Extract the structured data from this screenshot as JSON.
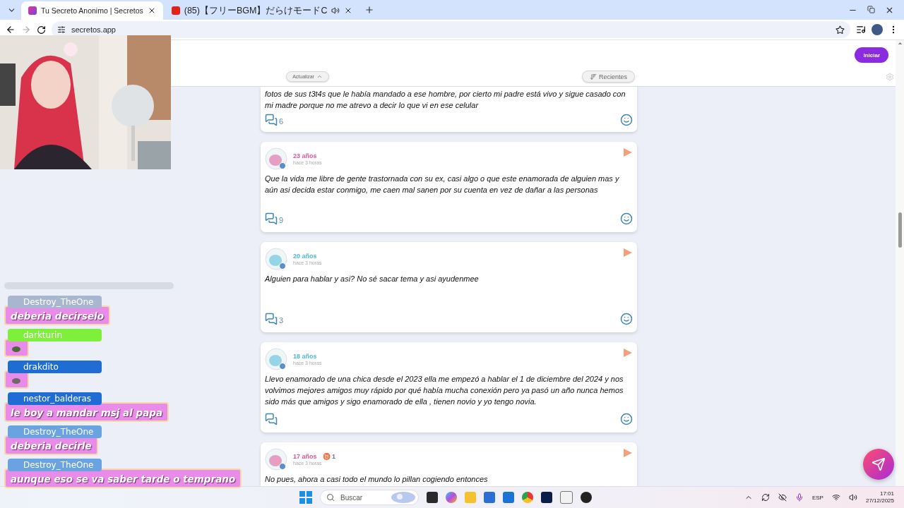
{
  "browser": {
    "tabs": [
      {
        "title": "Tu Secreto Anonimo | Secretos",
        "selected": true,
        "kind": "site",
        "audio": false
      },
      {
        "title": "(85)【フリーBGM】だらけモードC",
        "selected": false,
        "kind": "video",
        "audio": true
      }
    ],
    "address": "secretos.app"
  },
  "site": {
    "header": {
      "login_button": "Iniciar",
      "refresh_button": "Actualizar",
      "sort_button": "Recientes"
    },
    "posts": [
      {
        "text": "fotos de sus t3t4s que le había mandado a ese hombre, por cierto mi padre está vivo y sigue casado con mi madre porque no me atrevo a decir lo que vi en ese celular",
        "comments": "6",
        "footer": true
      },
      {
        "age": "23 años",
        "color": "#e0559a",
        "time": "hace 3 horas",
        "text": "Que la vida me libre de gente trastornada con su ex, casi algo o que este enamorada de alguien mas y aún asi decida estar conmigo, me caen mal sanen por su cuenta en vez de dañar a las personas",
        "comments": "9",
        "footer": true
      },
      {
        "age": "20 años",
        "color": "#4fb8dc",
        "time": "hace 3 horas",
        "text": "Alguien para hablar y asi? No sé sacar tema y asi ayudenmee",
        "comments": "3",
        "footer": true
      },
      {
        "age": "18 años",
        "color": "#4fb8dc",
        "time": "hace 3 horas",
        "text": "Llevo enamorado de una chica desde el 2023 ella me empezó a hablar el 1 de diciembre del 2024 y nos volvimos mejores amigos muy rápido por qué había mucha conexión pero ya pasó un año nunca hemos sido más que amigos y sigo enamorado de ella , tienen novio y yo tengo novia.",
        "footer": true
      },
      {
        "age": "17 años",
        "color": "#e0559a",
        "badge": "♉ 1",
        "time": "hace 3 horas",
        "text": "No pues, ahora a casi todo el mundo lo pillan cogiendo entonces"
      }
    ]
  },
  "stream_overlay": {
    "chat": [
      {
        "user": "Destroy_TheOne",
        "color": "#a9b6cf",
        "kind": "text",
        "message": "deberia decirselo"
      },
      {
        "user": "darkturin",
        "color": "#7ef03c",
        "kind": "emote"
      },
      {
        "user": "drakdito",
        "color": "#1f6dd4",
        "kind": "emote"
      },
      {
        "user": "nestor_balderas",
        "color": "#1f6dd4",
        "kind": "text",
        "message": "le boy a mandar msj al papa"
      },
      {
        "user": "Destroy_TheOne",
        "color": "#6aa3e2",
        "kind": "text",
        "message": "deberia decirle"
      },
      {
        "user": "Destroy_TheOne",
        "color": "#6aa3e2",
        "kind": "text",
        "message": "aunque eso se va saber tarde o temprano"
      }
    ]
  },
  "taskbar": {
    "search_placeholder": "Buscar",
    "language": "ESP",
    "time": "17:01",
    "date": "27/12/2025"
  }
}
